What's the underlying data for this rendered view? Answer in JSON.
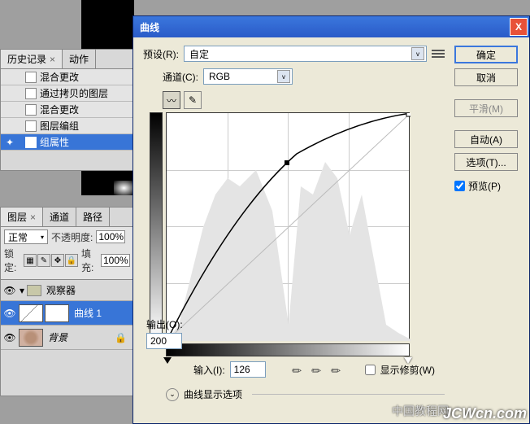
{
  "dialog": {
    "title": "曲线",
    "preset_label": "预设(R):",
    "preset_value": "自定",
    "channel_label": "通道(C):",
    "channel_value": "RGB",
    "output_label": "输出(O):",
    "output_value": "200",
    "input_label": "输入(I):",
    "input_value": "126",
    "show_clip": "显示修剪(W)",
    "display_options": "曲线显示选项",
    "ok": "确定",
    "cancel": "取消",
    "smooth": "平滑(M)",
    "auto": "自动(A)",
    "options": "选项(T)...",
    "preview": "预览(P)"
  },
  "history": {
    "tab1": "历史记录",
    "tab2": "动作",
    "items": [
      "混合更改",
      "通过拷贝的图层",
      "混合更改",
      "图层编组",
      "组属性"
    ]
  },
  "layers": {
    "tab1": "图层",
    "tab2": "通道",
    "tab3": "路径",
    "mode": "正常",
    "opacity_label": "不透明度:",
    "opacity_value": "100%",
    "lock_label": "锁定:",
    "fill_label": "填充:",
    "fill_value": "100%",
    "group": "观察器",
    "layer1": "曲线 1",
    "layer2": "背景"
  },
  "watermark": {
    "cn": "中国教程网",
    "en": "JCWcn.com"
  }
}
